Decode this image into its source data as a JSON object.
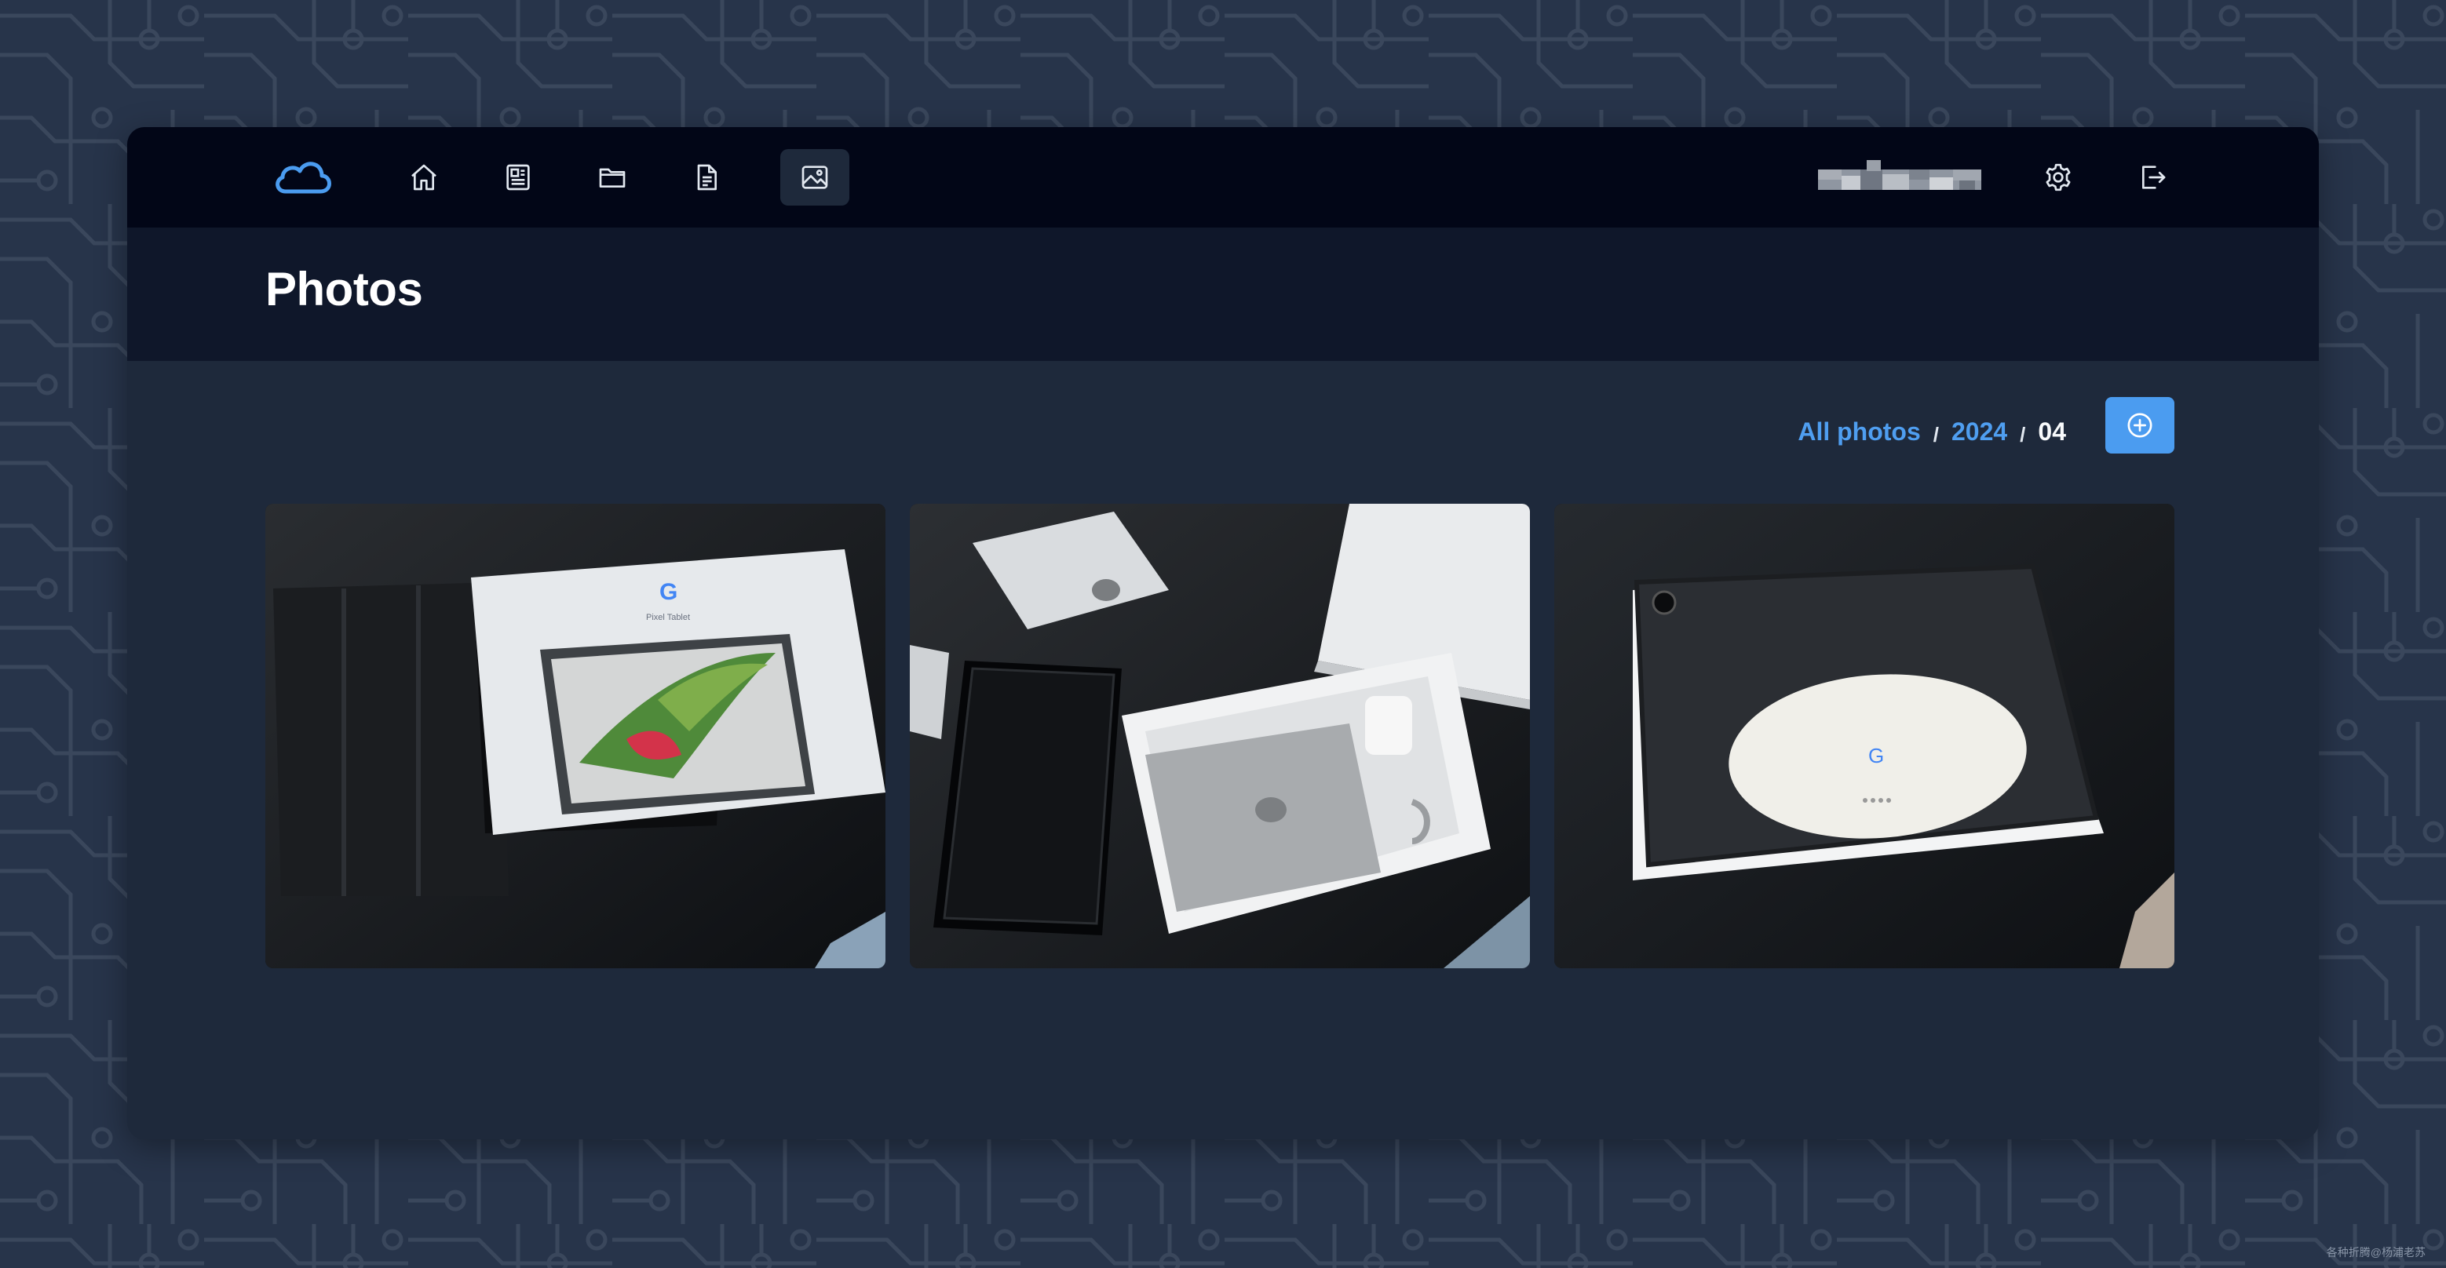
{
  "page": {
    "title": "Photos"
  },
  "nav": {
    "logo_icon": "cloud-icon",
    "items": [
      {
        "name": "home",
        "icon": "home-icon"
      },
      {
        "name": "news",
        "icon": "newspaper-icon"
      },
      {
        "name": "files",
        "icon": "folder-icon"
      },
      {
        "name": "documents",
        "icon": "document-icon"
      },
      {
        "name": "photos",
        "icon": "image-icon",
        "active": true
      }
    ],
    "user_name_redacted": true,
    "settings_icon": "gear-icon",
    "logout_icon": "logout-icon"
  },
  "breadcrumb": {
    "items": [
      "All photos",
      "2024",
      "04"
    ],
    "separator": "/"
  },
  "actions": {
    "add_icon": "plus-circle-icon"
  },
  "photos": [
    {
      "subject": "Tablet box with folio case"
    },
    {
      "subject": "Open tablet box contents"
    },
    {
      "subject": "Tablet in case on charging dock"
    }
  ],
  "watermark": "各种折腾@杨浦老苏",
  "colors": {
    "accent": "#4b9cf0",
    "link": "#4f9ef0",
    "topbar": "#020617",
    "header": "#0f172a",
    "card": "#1e293b",
    "background": "#27344a"
  }
}
